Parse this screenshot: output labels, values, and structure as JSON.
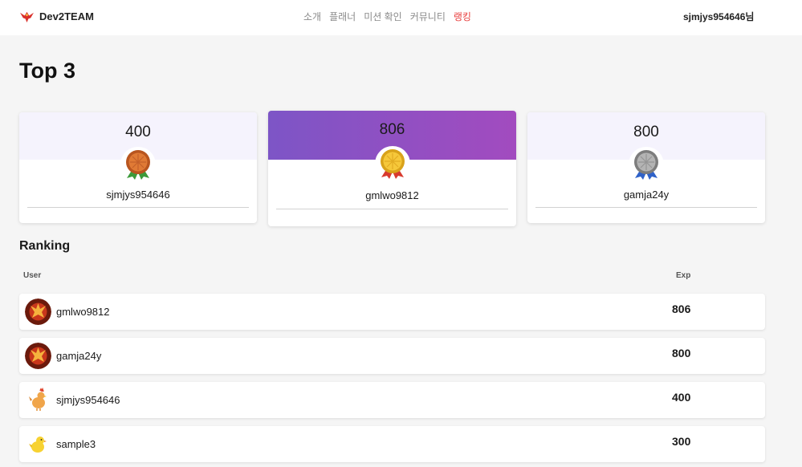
{
  "navbar": {
    "brand": "Dev2TEAM",
    "menu": [
      {
        "label": "소개",
        "active": false
      },
      {
        "label": "플래너",
        "active": false
      },
      {
        "label": "미션 확인",
        "active": false
      },
      {
        "label": "커뮤니티",
        "active": false
      },
      {
        "label": "랭킹",
        "active": true
      }
    ],
    "user": "sjmjys954646님"
  },
  "page_title": "Top 3",
  "top3": [
    {
      "score": "400",
      "name": "sjmjys954646",
      "medal": "bronze-medal-icon"
    },
    {
      "score": "806",
      "name": "gmlwo9812",
      "medal": "gold-medal-icon"
    },
    {
      "score": "800",
      "name": "gamja24y",
      "medal": "silver-medal-icon"
    }
  ],
  "ranking": {
    "title": "Ranking",
    "columns": {
      "user": "User",
      "exp": "Exp"
    },
    "rows": [
      {
        "name": "gmlwo9812",
        "exp": "806",
        "avatar": "phoenix-icon"
      },
      {
        "name": "gamja24y",
        "exp": "800",
        "avatar": "phoenix-icon"
      },
      {
        "name": "sjmjys954646",
        "exp": "400",
        "avatar": "chicken-icon"
      },
      {
        "name": "sample3",
        "exp": "300",
        "avatar": "chick-icon"
      }
    ]
  },
  "colors": {
    "accent": "#e8403f",
    "gold_band_start": "#7d55c6",
    "gold_band_end": "#a24bbf",
    "band": "#f5f3fd"
  }
}
